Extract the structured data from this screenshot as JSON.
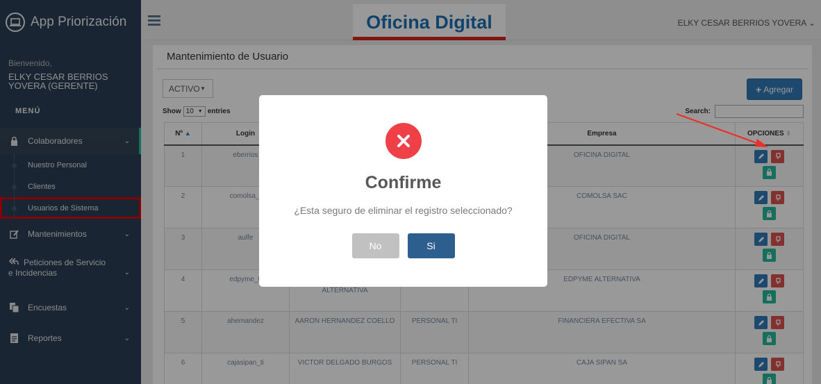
{
  "app": {
    "title": "App Priorización"
  },
  "sidebar": {
    "welcome": "Bienvenido,",
    "user_name": "ELKY CESAR BERRIOS YOVERA (GERENTE)",
    "menu_title": "MENÚ",
    "groups": [
      {
        "label": "Colaboradores",
        "icon": "lock-icon",
        "items": [
          "Nuestro Personal",
          "Clientes",
          "Usuarios de Sistema"
        ]
      },
      {
        "label": "Mantenimientos",
        "icon": "edit-icon"
      },
      {
        "label": "Peticiones de Servicio e Incidencias",
        "icon": "reply-all-icon"
      },
      {
        "label": "Encuestas",
        "icon": "files-icon"
      },
      {
        "label": "Reportes",
        "icon": "file-text-icon"
      }
    ]
  },
  "topnav": {
    "logo_text": "Oficina Digital",
    "user": "ELKY CESAR BERRIOS YOVERA"
  },
  "panel": {
    "title": "Mantenimiento de Usuario",
    "filter_value": "ACTIVO",
    "add_label": "Agregar",
    "show_label": "Show",
    "entries_value": "10",
    "entries_label": "entries",
    "search_label": "Search:"
  },
  "table": {
    "headers": [
      "Nº",
      "Login",
      "",
      "",
      "Empresa",
      "OPCIONES"
    ],
    "rows": [
      {
        "n": "1",
        "login": "eberrios",
        "name": "",
        "area": "",
        "empresa": "OFICINA DIGITAL"
      },
      {
        "n": "2",
        "login": "comolsa_t",
        "name": "",
        "area": "",
        "empresa": "COMOLSA SAC"
      },
      {
        "n": "3",
        "login": "aulfe",
        "name": "",
        "area": "",
        "empresa": "OFICINA DIGITAL"
      },
      {
        "n": "4",
        "login": "edpyme_ti",
        "name": "ALTERNATIVA",
        "area": "",
        "empresa": "EDPYME ALTERNATIVA"
      },
      {
        "n": "5",
        "login": "ahernandez",
        "name": "AARON HERNANDEZ COELLO",
        "area": "PERSONAL TI",
        "empresa": "FINANCIERA EFECTIVA SA"
      },
      {
        "n": "6",
        "login": "cajasipan_ti",
        "name": "VICTOR DELGADO BURGOS",
        "area": "PERSONAL TI",
        "empresa": "CAJA SIPAN SA"
      }
    ]
  },
  "modal": {
    "icon": "close-icon",
    "title": "Confirme",
    "text": "¿Esta seguro de eliminar el registro seleccionado?",
    "no_label": "No",
    "yes_label": "Si"
  },
  "colors": {
    "sidebar": "#2a3f54",
    "accent": "#1ABB9C",
    "primary": "#337ab7",
    "danger": "#d9534f",
    "success": "#26b99a"
  }
}
